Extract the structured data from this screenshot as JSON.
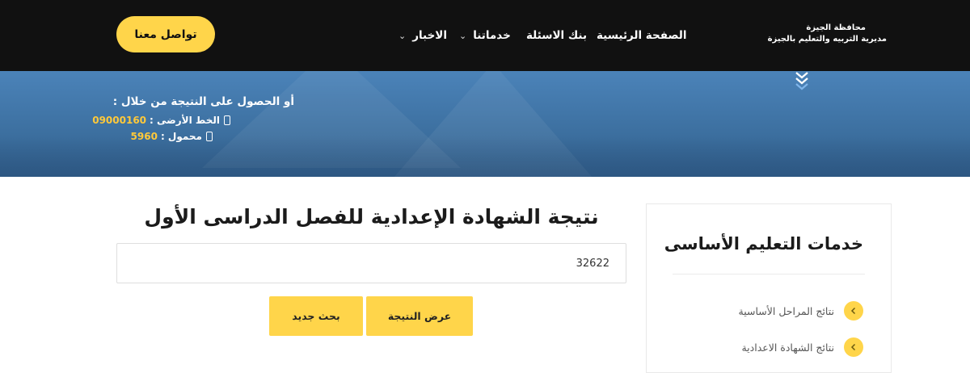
{
  "header": {
    "contact_label": "تواصل معنا",
    "nav": {
      "home": "الصفحة الرئيسية",
      "question_bank": "بنك الاسئلة",
      "services": "خدماتنا",
      "news": "الاخبار"
    },
    "brand": {
      "line1": "محافظة الجيزة",
      "line2": "مديرية التربيه والتعليم بالجيزة"
    }
  },
  "banner": {
    "intro": "أو الحصول على النتيجة من خلال :",
    "landline_label": "الخط الأرضى :",
    "landline_number": "09000160",
    "mobile_label": "محمول :",
    "mobile_number": "5960"
  },
  "main": {
    "title": "نتيجة الشهادة الإعدادية للفصل الدراسى الأول",
    "search_value": "32622",
    "show_result_label": "عرض النتيجة",
    "new_search_label": "بحث جديد"
  },
  "sidebar": {
    "title": "خدمات التعليم الأساسى",
    "items": [
      {
        "label": "نتائج المراحل الأساسية"
      },
      {
        "label": "نتائج الشهادة الاعدادية"
      }
    ]
  },
  "colors": {
    "accent": "#ffd54a",
    "header_bg": "#111111",
    "number_highlight": "#ffc93a"
  }
}
